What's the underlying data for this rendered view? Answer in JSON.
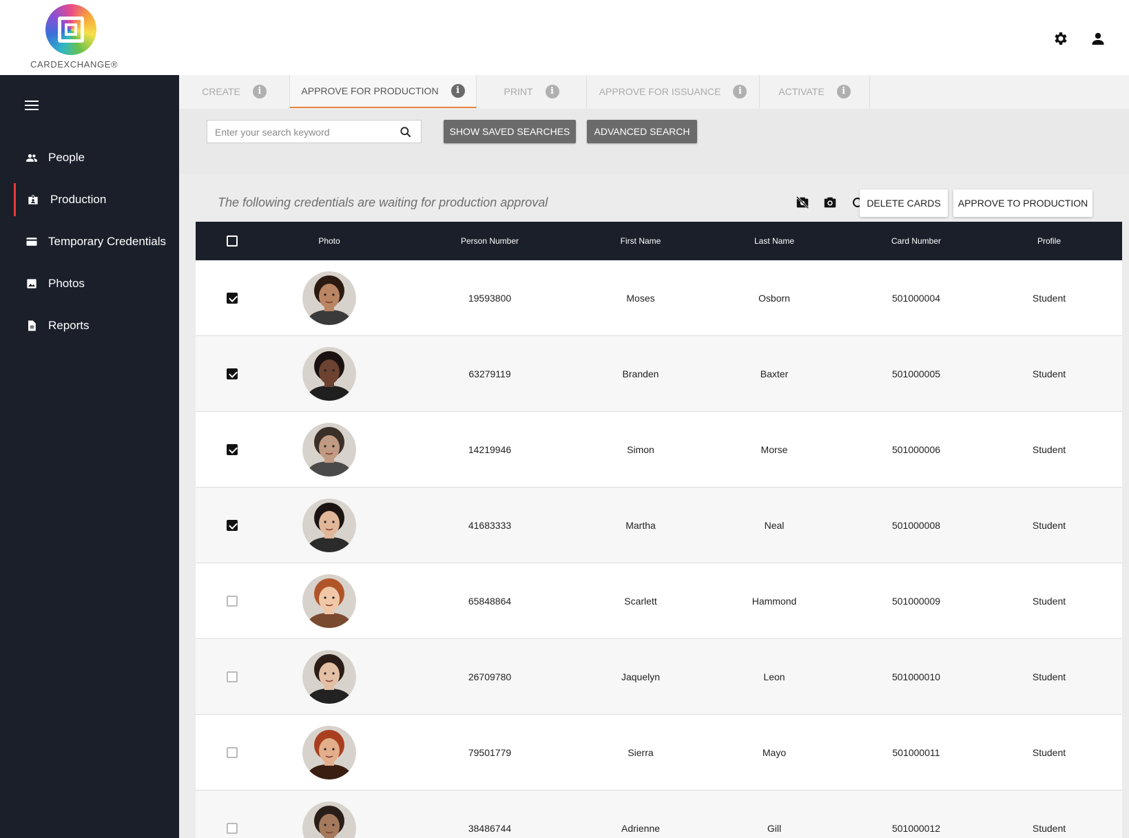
{
  "app": {
    "logo_text": "CARDEXCHANGE®"
  },
  "header": {
    "settings_icon": "gear-icon",
    "user_icon": "account-icon"
  },
  "sidebar": {
    "menu_icon": "hamburger-menu-icon",
    "items": [
      {
        "label": "People",
        "icon": "people-icon",
        "active": false
      },
      {
        "label": "Production",
        "icon": "badge-icon",
        "active": true
      },
      {
        "label": "Temporary Credentials",
        "icon": "credit-card-icon",
        "active": false
      },
      {
        "label": "Photos",
        "icon": "image-icon",
        "active": false
      },
      {
        "label": "Reports",
        "icon": "document-icon",
        "active": false
      }
    ]
  },
  "tabs": [
    {
      "label": "CREATE",
      "active": false
    },
    {
      "label": "APPROVE FOR PRODUCTION",
      "active": true
    },
    {
      "label": "PRINT",
      "active": false
    },
    {
      "label": "APPROVE FOR ISSUANCE",
      "active": false
    },
    {
      "label": "ACTIVATE",
      "active": false
    }
  ],
  "search": {
    "placeholder": "Enter your search keyword",
    "value": "",
    "saved_label": "SHOW SAVED SEARCHES",
    "advanced_label": "ADVANCED SEARCH"
  },
  "toolbar": {
    "caption": "The following credentials are waiting for production approval",
    "delete_label": "DELETE CARDS",
    "approve_label": "APPROVE TO PRODUCTION",
    "icons": [
      "no-photo-icon",
      "camera-icon",
      "refresh-icon"
    ]
  },
  "table": {
    "columns": [
      "Photo",
      "Person Number",
      "First Name",
      "Last Name",
      "Card Number",
      "Profile"
    ],
    "rows": [
      {
        "checked": true,
        "person_number": "19593800",
        "first_name": "Moses",
        "last_name": "Osborn",
        "card_number": "501000004",
        "profile": "Student",
        "skin": "#b98563",
        "hair": "#2a1a12",
        "shirt": "#3a3a3a"
      },
      {
        "checked": true,
        "person_number": "63279119",
        "first_name": "Branden",
        "last_name": "Baxter",
        "card_number": "501000005",
        "profile": "Student",
        "skin": "#6b4330",
        "hair": "#1a1210",
        "shirt": "#1f1f1f"
      },
      {
        "checked": true,
        "person_number": "14219946",
        "first_name": "Simon",
        "last_name": "Morse",
        "card_number": "501000006",
        "profile": "Student",
        "skin": "#c09a82",
        "hair": "#3b3028",
        "shirt": "#4a4a4a"
      },
      {
        "checked": true,
        "person_number": "41683333",
        "first_name": "Martha",
        "last_name": "Neal",
        "card_number": "501000008",
        "profile": "Student",
        "skin": "#e1b79a",
        "hair": "#1b1412",
        "shirt": "#2b2b2b"
      },
      {
        "checked": false,
        "person_number": "65848864",
        "first_name": "Scarlett",
        "last_name": "Hammond",
        "card_number": "501000009",
        "profile": "Student",
        "skin": "#f0c8a8",
        "hair": "#b0552a",
        "shirt": "#7a4a30"
      },
      {
        "checked": false,
        "person_number": "26709780",
        "first_name": "Jaquelyn",
        "last_name": "Leon",
        "card_number": "501000010",
        "profile": "Student",
        "skin": "#e3bfa4",
        "hair": "#2a1c16",
        "shirt": "#222222"
      },
      {
        "checked": false,
        "person_number": "79501779",
        "first_name": "Sierra",
        "last_name": "Mayo",
        "card_number": "501000011",
        "profile": "Student",
        "skin": "#e2ae8c",
        "hair": "#a8401f",
        "shirt": "#3a1e12"
      },
      {
        "checked": false,
        "person_number": "38486744",
        "first_name": "Adrienne",
        "last_name": "Gill",
        "card_number": "501000012",
        "profile": "Student",
        "skin": "#a57a5c",
        "hair": "#2a1e18",
        "shirt": "#2f9e3f"
      }
    ]
  },
  "colors": {
    "sidebar_bg": "#1b1f2a",
    "accent_tab": "#e8833a",
    "active_marker": "#e53935"
  }
}
